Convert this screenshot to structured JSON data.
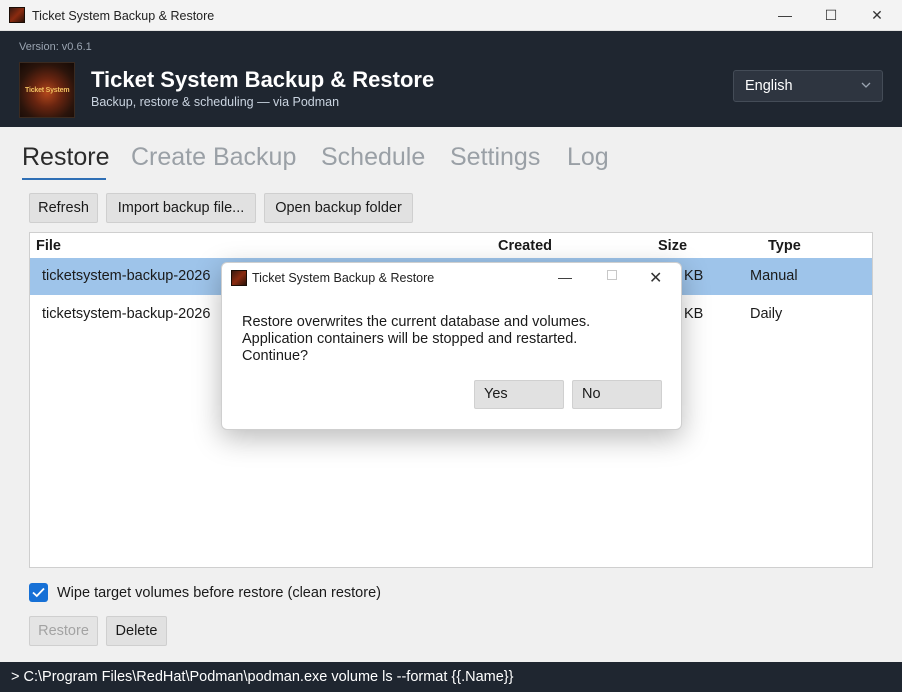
{
  "window": {
    "title": "Ticket System Backup & Restore",
    "minimize": "—",
    "maximize": "☐",
    "close": "✕"
  },
  "header": {
    "version": "Version: v0.6.1",
    "title": "Ticket System Backup & Restore",
    "subtitle": "Backup, restore & scheduling — via Podman",
    "logo_text": "Ticket System",
    "language": "English"
  },
  "tabs": [
    {
      "label": "Restore",
      "active": true
    },
    {
      "label": "Create Backup",
      "active": false
    },
    {
      "label": "Schedule",
      "active": false
    },
    {
      "label": "Settings",
      "active": false
    },
    {
      "label": "Log",
      "active": false
    }
  ],
  "toolbar": {
    "refresh": "Refresh",
    "import": "Import backup file...",
    "open_folder": "Open backup folder"
  },
  "table": {
    "columns": [
      "File",
      "Created",
      "Size",
      "Type"
    ],
    "rows": [
      {
        "file": "ticketsystem-backup-2026",
        "size": "KB",
        "type": "Manual",
        "selected": true
      },
      {
        "file": "ticketsystem-backup-2026",
        "size": "KB",
        "type": "Daily",
        "selected": false
      }
    ]
  },
  "options": {
    "wipe_label": "Wipe target volumes before restore (clean restore)",
    "wipe_checked": true
  },
  "actions": {
    "restore": "Restore",
    "delete": "Delete"
  },
  "status": {
    "text": "> C:\\Program Files\\RedHat\\Podman\\podman.exe volume ls --format {{.Name}}"
  },
  "dialog": {
    "title": "Ticket System Backup & Restore",
    "message_lines": [
      "Restore overwrites the current database and volumes.",
      "Application containers will be stopped and restarted.",
      "Continue?"
    ],
    "yes": "Yes",
    "no": "No",
    "minimize": "—",
    "close": "✕"
  },
  "colors": {
    "header_bg": "#1f2630",
    "accent": "#2f6fb5",
    "selection": "#9ec4ea",
    "checkbox": "#1670d6"
  }
}
